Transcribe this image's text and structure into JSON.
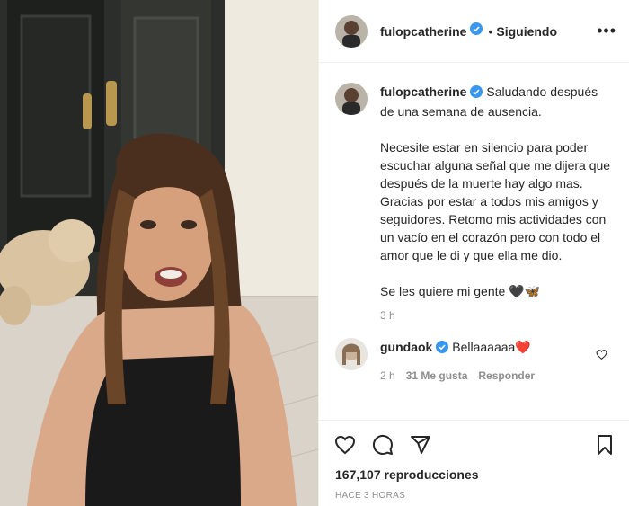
{
  "post": {
    "username": "fulopcatherine",
    "dot": "•",
    "following_label": "Siguiendo",
    "more_label": "•••"
  },
  "caption": {
    "username": "fulopcatherine",
    "line1": "Saludando después de una semana de ausencia.",
    "line2": "Necesite estar en silencio para poder escuchar alguna señal que me dijera que después de la muerte hay algo mas. Gracias por estar a todos mis amigos y seguidores. Retomo mis actividades con un vacío en el corazón pero con todo el amor que le di y que ella me dio.",
    "line3": "Se les quiere mi gente 🖤🦋",
    "time": "3 h"
  },
  "comment": {
    "username": "gundaok",
    "text": "Bellaaaaaa❤️",
    "time": "2 h",
    "likes": "31 Me gusta",
    "reply_label": "Responder"
  },
  "actions": {
    "views": "167,107 reproducciones",
    "posted_ago": "HACE 3 HORAS"
  },
  "colors": {
    "verified_blue": "#3897f0",
    "text": "#262626",
    "muted": "#8e8e8e",
    "border": "#efefef"
  },
  "icons": {
    "like": "heart-icon",
    "comment": "comment-icon",
    "share": "paper-plane-icon",
    "save": "bookmark-icon",
    "comment_like": "heart-outline-icon",
    "verified": "verified-badge-icon"
  }
}
